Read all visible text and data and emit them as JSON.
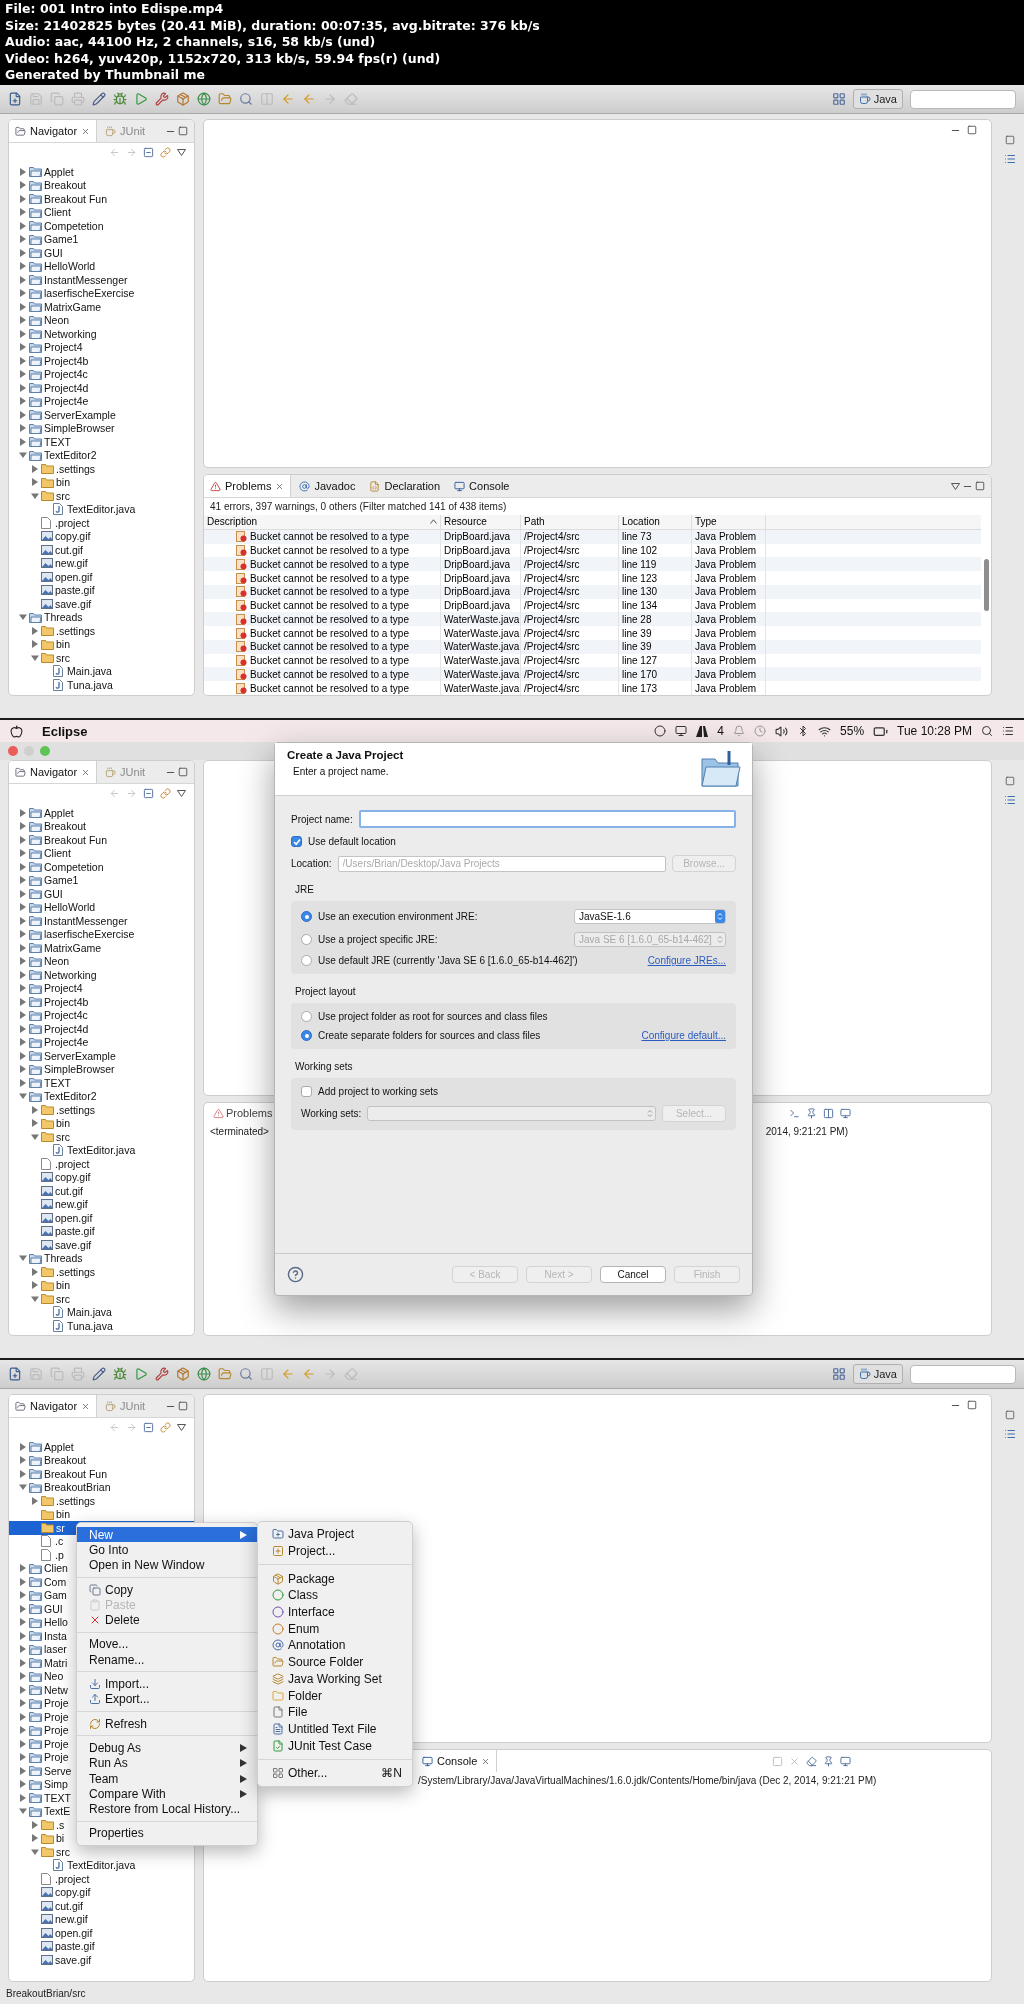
{
  "header": {
    "lines": [
      "File: 001 Intro into Edispe.mp4",
      "Size: 21402825 bytes (20.41 MiB), duration: 00:07:35, avg.bitrate: 376 kb/s",
      "Audio: aac, 44100 Hz, 2 channels, s16, 58 kb/s (und)",
      "Video: h264, yuv420p, 1152x720, 313 kb/s, 59.94 fps(r) (und)",
      "Generated by Thumbnail me"
    ]
  },
  "frame_1": {
    "toolbar": {
      "perspective": "Java"
    },
    "navigator": {
      "tabs": [
        {
          "label": "Navigator",
          "selected": true
        },
        {
          "label": "JUnit",
          "selected": false
        }
      ],
      "tree": [
        {
          "name": "Applet",
          "kind": "project",
          "expanded": false
        },
        {
          "name": "Breakout",
          "kind": "project",
          "expanded": false
        },
        {
          "name": "Breakout Fun",
          "kind": "project",
          "expanded": false
        },
        {
          "name": "Client",
          "kind": "project",
          "expanded": false
        },
        {
          "name": "Competetion",
          "kind": "project",
          "expanded": false
        },
        {
          "name": "Game1",
          "kind": "project",
          "expanded": false
        },
        {
          "name": "GUI",
          "kind": "project",
          "expanded": false
        },
        {
          "name": "HelloWorld",
          "kind": "project",
          "expanded": false
        },
        {
          "name": "InstantMessenger",
          "kind": "project",
          "expanded": false
        },
        {
          "name": "laserfischeExercise",
          "kind": "project",
          "expanded": false
        },
        {
          "name": "MatrixGame",
          "kind": "project",
          "expanded": false
        },
        {
          "name": "Neon",
          "kind": "project",
          "expanded": false
        },
        {
          "name": "Networking",
          "kind": "project",
          "expanded": false
        },
        {
          "name": "Project4",
          "kind": "project",
          "expanded": false
        },
        {
          "name": "Project4b",
          "kind": "project",
          "expanded": false
        },
        {
          "name": "Project4c",
          "kind": "project",
          "expanded": false
        },
        {
          "name": "Project4d",
          "kind": "project",
          "expanded": false
        },
        {
          "name": "Project4e",
          "kind": "project",
          "expanded": false
        },
        {
          "name": "ServerExample",
          "kind": "project",
          "expanded": false
        },
        {
          "name": "SimpleBrowser",
          "kind": "project",
          "expanded": false
        },
        {
          "name": "TEXT",
          "kind": "project",
          "expanded": false
        },
        {
          "name": "TextEditor2",
          "kind": "project",
          "expanded": true,
          "children": [
            {
              "name": ".settings",
              "kind": "folder",
              "expanded": false
            },
            {
              "name": "bin",
              "kind": "folder",
              "expanded": false
            },
            {
              "name": "src",
              "kind": "folder",
              "expanded": true,
              "children": [
                {
                  "name": "TextEditor.java",
                  "kind": "java"
                }
              ]
            },
            {
              "name": ".project",
              "kind": "file"
            },
            {
              "name": "copy.gif",
              "kind": "image"
            },
            {
              "name": "cut.gif",
              "kind": "image"
            },
            {
              "name": "new.gif",
              "kind": "image"
            },
            {
              "name": "open.gif",
              "kind": "image"
            },
            {
              "name": "paste.gif",
              "kind": "image"
            },
            {
              "name": "save.gif",
              "kind": "image"
            }
          ]
        },
        {
          "name": "Threads",
          "kind": "project",
          "expanded": true,
          "children": [
            {
              "name": ".settings",
              "kind": "folder",
              "expanded": false
            },
            {
              "name": "bin",
              "kind": "folder",
              "expanded": false
            },
            {
              "name": "src",
              "kind": "folder",
              "expanded": true,
              "children": [
                {
                  "name": "Main.java",
                  "kind": "java"
                },
                {
                  "name": "Tuna.java",
                  "kind": "java"
                }
              ]
            }
          ]
        }
      ]
    },
    "problems": {
      "tabs": [
        {
          "label": "Problems",
          "selected": true
        },
        {
          "label": "Javadoc",
          "selected": false
        },
        {
          "label": "Declaration",
          "selected": false
        },
        {
          "label": "Console",
          "selected": false
        }
      ],
      "summary": "41 errors, 397 warnings, 0 others (Filter matched 141 of 438 items)",
      "columns": [
        "Description",
        "Resource",
        "Path",
        "Location",
        "Type"
      ],
      "rows": [
        {
          "description": "Bucket cannot be resolved to a type",
          "resource": "DripBoard.java",
          "path": "/Project4/src",
          "location": "line 73",
          "type": "Java Problem"
        },
        {
          "description": "Bucket cannot be resolved to a type",
          "resource": "DripBoard.java",
          "path": "/Project4/src",
          "location": "line 102",
          "type": "Java Problem"
        },
        {
          "description": "Bucket cannot be resolved to a type",
          "resource": "DripBoard.java",
          "path": "/Project4/src",
          "location": "line 119",
          "type": "Java Problem"
        },
        {
          "description": "Bucket cannot be resolved to a type",
          "resource": "DripBoard.java",
          "path": "/Project4/src",
          "location": "line 123",
          "type": "Java Problem"
        },
        {
          "description": "Bucket cannot be resolved to a type",
          "resource": "DripBoard.java",
          "path": "/Project4/src",
          "location": "line 130",
          "type": "Java Problem"
        },
        {
          "description": "Bucket cannot be resolved to a type",
          "resource": "DripBoard.java",
          "path": "/Project4/src",
          "location": "line 134",
          "type": "Java Problem"
        },
        {
          "description": "Bucket cannot be resolved to a type",
          "resource": "WaterWaste.java",
          "path": "/Project4/src",
          "location": "line 28",
          "type": "Java Problem"
        },
        {
          "description": "Bucket cannot be resolved to a type",
          "resource": "WaterWaste.java",
          "path": "/Project4/src",
          "location": "line 39",
          "type": "Java Problem"
        },
        {
          "description": "Bucket cannot be resolved to a type",
          "resource": "WaterWaste.java",
          "path": "/Project4/src",
          "location": "line 39",
          "type": "Java Problem"
        },
        {
          "description": "Bucket cannot be resolved to a type",
          "resource": "WaterWaste.java",
          "path": "/Project4/src",
          "location": "line 127",
          "type": "Java Problem"
        },
        {
          "description": "Bucket cannot be resolved to a type",
          "resource": "WaterWaste.java",
          "path": "/Project4/src",
          "location": "line 170",
          "type": "Java Problem"
        },
        {
          "description": "Bucket cannot be resolved to a type",
          "resource": "WaterWaste.java",
          "path": "/Project4/src",
          "location": "line 173",
          "type": "Java Problem"
        }
      ]
    }
  },
  "frame_2": {
    "menu_bar": {
      "app": "Eclipse",
      "badge": "4",
      "battery": "55%",
      "clock": "Tue 10:28 PM"
    },
    "navigator": {
      "tabs": [
        {
          "label": "Navigator",
          "selected": true
        },
        {
          "label": "JUnit",
          "selected": false
        }
      ],
      "tree": [
        {
          "name": "Applet",
          "kind": "project",
          "expanded": false
        },
        {
          "name": "Breakout",
          "kind": "project",
          "expanded": false
        },
        {
          "name": "Breakout Fun",
          "kind": "project",
          "expanded": false
        },
        {
          "name": "Client",
          "kind": "project",
          "expanded": false
        },
        {
          "name": "Competetion",
          "kind": "project",
          "expanded": false
        },
        {
          "name": "Game1",
          "kind": "project",
          "expanded": false
        },
        {
          "name": "GUI",
          "kind": "project",
          "expanded": false
        },
        {
          "name": "HelloWorld",
          "kind": "project",
          "expanded": false
        },
        {
          "name": "InstantMessenger",
          "kind": "project",
          "expanded": false
        },
        {
          "name": "laserfischeExercise",
          "kind": "project",
          "expanded": false
        },
        {
          "name": "MatrixGame",
          "kind": "project",
          "expanded": false
        },
        {
          "name": "Neon",
          "kind": "project",
          "expanded": false
        },
        {
          "name": "Networking",
          "kind": "project",
          "expanded": false
        },
        {
          "name": "Project4",
          "kind": "project",
          "expanded": false
        },
        {
          "name": "Project4b",
          "kind": "project",
          "expanded": false
        },
        {
          "name": "Project4c",
          "kind": "project",
          "expanded": false
        },
        {
          "name": "Project4d",
          "kind": "project",
          "expanded": false
        },
        {
          "name": "Project4e",
          "kind": "project",
          "expanded": false
        },
        {
          "name": "ServerExample",
          "kind": "project",
          "expanded": false
        },
        {
          "name": "SimpleBrowser",
          "kind": "project",
          "expanded": false
        },
        {
          "name": "TEXT",
          "kind": "project",
          "expanded": false
        },
        {
          "name": "TextEditor2",
          "kind": "project",
          "expanded": true,
          "children": [
            {
              "name": ".settings",
              "kind": "folder",
              "expanded": false
            },
            {
              "name": "bin",
              "kind": "folder",
              "expanded": false
            },
            {
              "name": "src",
              "kind": "folder",
              "expanded": true,
              "children": [
                {
                  "name": "TextEditor.java",
                  "kind": "java"
                }
              ]
            },
            {
              "name": ".project",
              "kind": "file"
            },
            {
              "name": "copy.gif",
              "kind": "image"
            },
            {
              "name": "cut.gif",
              "kind": "image"
            },
            {
              "name": "new.gif",
              "kind": "image"
            },
            {
              "name": "open.gif",
              "kind": "image"
            },
            {
              "name": "paste.gif",
              "kind": "image"
            },
            {
              "name": "save.gif",
              "kind": "image"
            }
          ]
        },
        {
          "name": "Threads",
          "kind": "project",
          "expanded": true,
          "children": [
            {
              "name": ".settings",
              "kind": "folder",
              "expanded": false
            },
            {
              "name": "bin",
              "kind": "folder",
              "expanded": false
            },
            {
              "name": "src",
              "kind": "folder",
              "expanded": true,
              "children": [
                {
                  "name": "Main.java",
                  "kind": "java"
                },
                {
                  "name": "Tuna.java",
                  "kind": "java"
                }
              ]
            }
          ]
        }
      ]
    },
    "bottom_panel": {
      "tab": "Problems",
      "left_text": "<terminated>",
      "right_text": "2014, 9:21:21 PM)"
    },
    "dialog": {
      "title": "Create a Java Project",
      "subtitle": "Enter a project name.",
      "project_name": {
        "label": "Project name:",
        "focused": true
      },
      "use_default_location": {
        "label": "Use default location",
        "checked": true
      },
      "location": {
        "label": "Location:",
        "value": "/Users/Brian/Desktop/Java Projects",
        "disabled": true
      },
      "browse": {
        "label": "Browse...",
        "disabled": true
      },
      "jre": {
        "title": "JRE",
        "options": [
          {
            "label": "Use an execution environment JRE:",
            "selected": true,
            "select": {
              "value": "JavaSE-1.6",
              "disabled": false
            }
          },
          {
            "label": "Use a project specific JRE:",
            "selected": false,
            "select": {
              "value": "Java SE 6 [1.6.0_65-b14-462]",
              "disabled": true
            }
          },
          {
            "label": "Use default JRE (currently 'Java SE 6 [1.6.0_65-b14-462]')",
            "selected": false,
            "link": "Configure JREs..."
          }
        ]
      },
      "layout": {
        "title": "Project layout",
        "options": [
          {
            "label": "Use project folder as root for sources and class files",
            "selected": false
          },
          {
            "label": "Create separate folders for sources and class files",
            "selected": true,
            "link": "Configure default..."
          }
        ]
      },
      "working_sets": {
        "title": "Working sets",
        "checkbox": {
          "label": "Add project to working sets",
          "checked": false
        },
        "label": "Working sets:",
        "select": {
          "disabled": true
        },
        "button": {
          "label": "Select...",
          "disabled": true
        }
      },
      "buttons": [
        {
          "label": "< Back",
          "disabled": true
        },
        {
          "label": "Next >",
          "disabled": true
        },
        {
          "label": "Cancel",
          "disabled": false
        },
        {
          "label": "Finish",
          "disabled": true
        }
      ]
    }
  },
  "frame_3": {
    "toolbar": {
      "perspective": "Java"
    },
    "navigator": {
      "tabs": [
        {
          "label": "Navigator",
          "selected": true
        },
        {
          "label": "JUnit",
          "selected": false
        }
      ],
      "tree": [
        {
          "name": "Applet",
          "kind": "project",
          "expanded": false,
          "selected": false
        },
        {
          "name": "Breakout",
          "kind": "project",
          "expanded": false,
          "selected": false
        },
        {
          "name": "Breakout Fun",
          "kind": "project",
          "expanded": false,
          "selected": false
        },
        {
          "name": "BreakoutBrian",
          "kind": "project",
          "expanded": true,
          "selected": false,
          "children": [
            {
              "name": ".settings",
              "kind": "folder",
              "expanded": false,
              "selected": false
            },
            {
              "name": "bin",
              "kind": "folder",
              "selected": false
            },
            {
              "name": "sr",
              "kind": "folder",
              "selected": true
            },
            {
              "name": ".c",
              "kind": "file",
              "selected": false
            },
            {
              "name": ".p",
              "kind": "file",
              "selected": false
            }
          ]
        },
        {
          "name": "Clien",
          "kind": "project",
          "expanded": false,
          "selected": false
        },
        {
          "name": "Com",
          "kind": "project",
          "expanded": false,
          "selected": false
        },
        {
          "name": "Gam",
          "kind": "project",
          "expanded": false,
          "selected": false
        },
        {
          "name": "GUI",
          "kind": "project",
          "expanded": false,
          "selected": false
        },
        {
          "name": "Hello",
          "kind": "project",
          "expanded": false,
          "selected": false
        },
        {
          "name": "Insta",
          "kind": "project",
          "expanded": false,
          "selected": false
        },
        {
          "name": "laser",
          "kind": "project",
          "expanded": false,
          "selected": false
        },
        {
          "name": "Matri",
          "kind": "project",
          "expanded": false,
          "selected": false
        },
        {
          "name": "Neo",
          "kind": "project",
          "expanded": false,
          "selected": false
        },
        {
          "name": "Netw",
          "kind": "project",
          "expanded": false,
          "selected": false
        },
        {
          "name": "Proje",
          "kind": "project",
          "expanded": false,
          "selected": false
        },
        {
          "name": "Proje",
          "kind": "project",
          "expanded": false,
          "selected": false
        },
        {
          "name": "Proje",
          "kind": "project",
          "expanded": false,
          "selected": false
        },
        {
          "name": "Proje",
          "kind": "project",
          "expanded": false,
          "selected": false
        },
        {
          "name": "Proje",
          "kind": "project",
          "expanded": false,
          "selected": false
        },
        {
          "name": "Serve",
          "kind": "project",
          "expanded": false,
          "selected": false
        },
        {
          "name": "Simp",
          "kind": "project",
          "expanded": false,
          "selected": false
        },
        {
          "name": "TEXT",
          "kind": "project",
          "expanded": false,
          "selected": false
        },
        {
          "name": "TextE",
          "kind": "project",
          "expanded": true,
          "selected": false,
          "children": [
            {
              "name": ".s",
              "kind": "folder",
              "expanded": false,
              "selected": false
            },
            {
              "name": "bi",
              "kind": "folder",
              "expanded": false,
              "selected": false
            },
            {
              "name": "src",
              "kind": "folder",
              "expanded": true,
              "selected": false,
              "children": [
                {
                  "name": "TextEditor.java",
                  "kind": "java",
                  "selected": false
                }
              ]
            },
            {
              "name": ".project",
              "kind": "file",
              "selected": false
            },
            {
              "name": "copy.gif",
              "kind": "image",
              "selected": false
            },
            {
              "name": "cut.gif",
              "kind": "image",
              "selected": false
            },
            {
              "name": "new.gif",
              "kind": "image",
              "selected": false
            },
            {
              "name": "open.gif",
              "kind": "image",
              "selected": false
            },
            {
              "name": "paste.gif",
              "kind": "image",
              "selected": false
            },
            {
              "name": "save.gif",
              "kind": "image",
              "selected": false
            }
          ]
        }
      ]
    },
    "context_menu": {
      "groups": [
        [
          {
            "label": "New",
            "submenu": true,
            "selected": true,
            "disabled": false
          },
          {
            "label": "Go Into",
            "selected": false,
            "disabled": false
          },
          {
            "label": "Open in New Window",
            "selected": false,
            "disabled": false
          }
        ],
        [
          {
            "label": "Copy",
            "selected": false,
            "disabled": false
          },
          {
            "label": "Paste",
            "selected": false,
            "disabled": true
          },
          {
            "label": "Delete",
            "selected": false,
            "disabled": false
          }
        ],
        [
          {
            "label": "Move...",
            "selected": false,
            "disabled": false
          },
          {
            "label": "Rename...",
            "selected": false,
            "disabled": false
          }
        ],
        [
          {
            "label": "Import...",
            "selected": false,
            "disabled": false
          },
          {
            "label": "Export...",
            "selected": false,
            "disabled": false
          }
        ],
        [
          {
            "label": "Refresh",
            "selected": false,
            "disabled": false
          }
        ],
        [
          {
            "label": "Debug As",
            "submenu": true,
            "selected": false,
            "disabled": false
          },
          {
            "label": "Run As",
            "submenu": true,
            "selected": false,
            "disabled": false
          },
          {
            "label": "Team",
            "submenu": true,
            "selected": false,
            "disabled": false
          },
          {
            "label": "Compare With",
            "submenu": true,
            "selected": false,
            "disabled": false
          },
          {
            "label": "Restore from Local History...",
            "selected": false,
            "disabled": false
          }
        ],
        [
          {
            "label": "Properties",
            "selected": false,
            "disabled": false
          }
        ]
      ]
    },
    "submenu": {
      "groups": [
        [
          {
            "label": "Java Project"
          },
          {
            "label": "Project..."
          }
        ],
        [
          {
            "label": "Package"
          },
          {
            "label": "Class"
          },
          {
            "label": "Interface"
          },
          {
            "label": "Enum"
          },
          {
            "label": "Annotation"
          },
          {
            "label": "Source Folder"
          },
          {
            "label": "Java Working Set"
          },
          {
            "label": "Folder"
          },
          {
            "label": "File"
          },
          {
            "label": "Untitled Text File"
          },
          {
            "label": "JUnit Test Case"
          }
        ],
        [
          {
            "label": "Other...",
            "shortcut": "⌘N"
          }
        ]
      ]
    },
    "console": {
      "tab": "Console",
      "text": "/System/Library/Java/JavaVirtualMachines/1.6.0.jdk/Contents/Home/bin/java (Dec 2, 2014, 9:21:21 PM)"
    },
    "status_bar": "BreakoutBrian/src"
  }
}
